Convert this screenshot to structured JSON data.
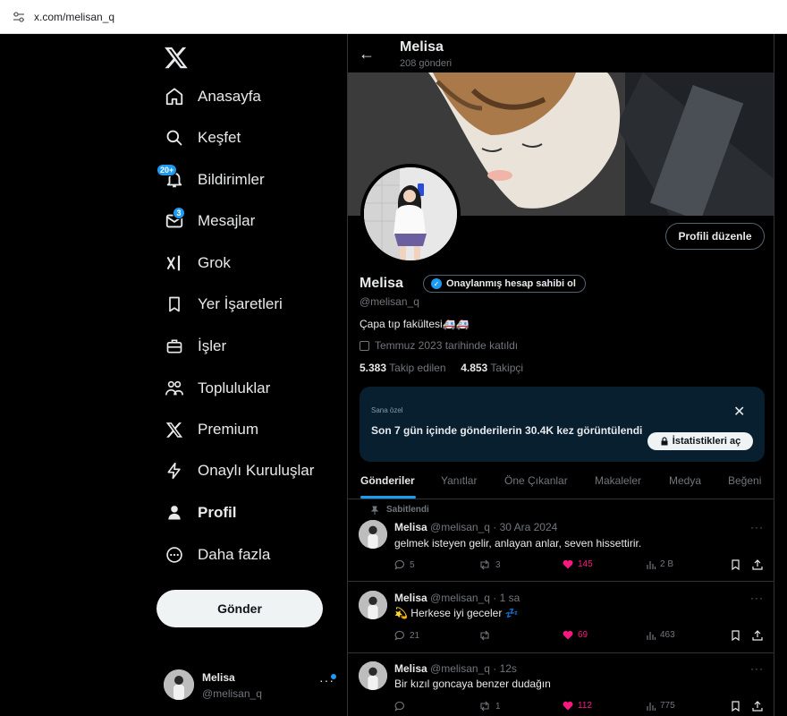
{
  "browser": {
    "url": "x.com/melisan_q"
  },
  "nav": {
    "items": [
      {
        "label": "Anasayfa",
        "icon": "home-icon"
      },
      {
        "label": "Keşfet",
        "icon": "search-icon"
      },
      {
        "label": "Bildirimler",
        "icon": "bell-icon",
        "badge": "20+"
      },
      {
        "label": "Mesajlar",
        "icon": "mail-icon",
        "badge": "3"
      },
      {
        "label": "Grok",
        "icon": "grok-icon"
      },
      {
        "label": "Yer İşaretleri",
        "icon": "bookmark-icon"
      },
      {
        "label": "İşler",
        "icon": "briefcase-icon"
      },
      {
        "label": "Topluluklar",
        "icon": "communities-icon"
      },
      {
        "label": "Premium",
        "icon": "x-logo-icon"
      },
      {
        "label": "Onaylı Kuruluşlar",
        "icon": "lightning-icon"
      },
      {
        "label": "Profil",
        "icon": "person-icon",
        "active": true
      },
      {
        "label": "Daha fazla",
        "icon": "more-circle-icon"
      }
    ],
    "post_button": "Gönder",
    "account": {
      "name": "Melisa",
      "handle": "@melisan_q",
      "more": "···"
    }
  },
  "header": {
    "back": "←",
    "name": "Melisa",
    "post_count": "208 gönderi"
  },
  "profile": {
    "edit_button": "Profili düzenle",
    "name": "Melisa",
    "verify_pill": "Onaylanmış hesap sahibi ol",
    "handle": "@melisan_q",
    "bio": "Çapa tıp fakültesi🚑🚑",
    "joined": "Temmuz 2023 tarihinde katıldı",
    "following_count": "5.383",
    "following_label": "Takip edilen",
    "followers_count": "4.853",
    "followers_label": "Takipçi"
  },
  "promo": {
    "tag": "Sana özel",
    "text": "Son 7 gün içinde gönderilerin 30.4K kez görüntülendi",
    "close": "✕",
    "button": "İstatistikleri aç"
  },
  "tabs": [
    "Gönderiler",
    "Yanıtlar",
    "Öne Çıkanlar",
    "Makaleler",
    "Medya",
    "Beğeni"
  ],
  "posts": [
    {
      "pinned": "Sabitlendi",
      "name": "Melisa",
      "meta": "@melisan_q · 30 Ara 2024",
      "text": "gelmek isteyen gelir, anlayan anlar, seven hissettirir.",
      "replies": "5",
      "reposts": "3",
      "likes": "145",
      "views": "2 B"
    },
    {
      "name": "Melisa",
      "meta": "@melisan_q · 1 sa",
      "text": "💫 Herkese iyi geceler 💤",
      "replies": "21",
      "reposts": "",
      "likes": "69",
      "views": "463"
    },
    {
      "name": "Melisa",
      "meta": "@melisan_q · 12s",
      "text": "Bir kızıl goncaya benzer dudağın",
      "replies": "",
      "reposts": "1",
      "likes": "112",
      "views": "775"
    }
  ],
  "colors": {
    "accent": "#1d9bf0",
    "like": "#f91880",
    "background": "#000000",
    "promo_bg": "#071f2f"
  }
}
